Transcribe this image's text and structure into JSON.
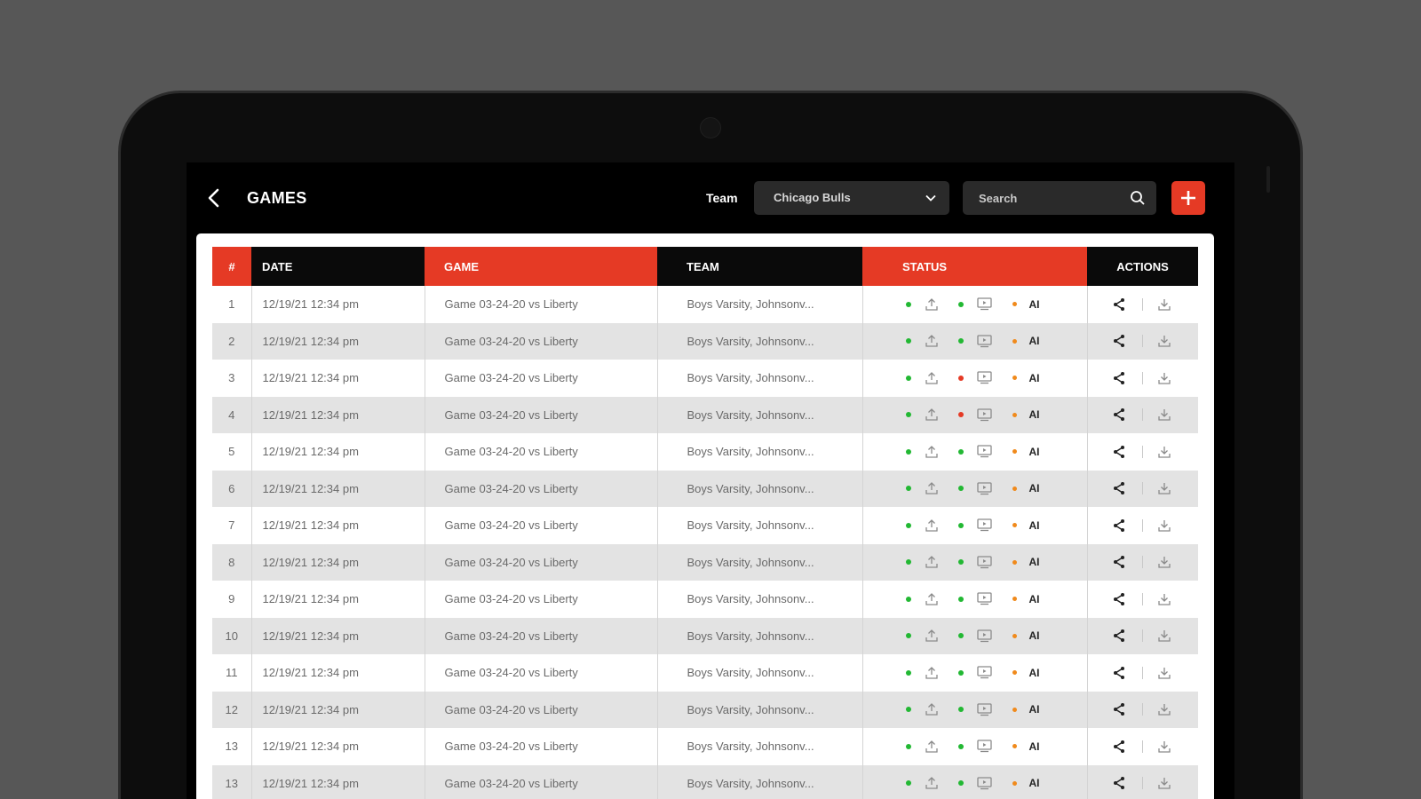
{
  "header": {
    "title": "GAMES",
    "team_label": "Team",
    "team_selected": "Chicago Bulls",
    "search_placeholder": "Search"
  },
  "colors": {
    "accent": "#e53a25",
    "status_green": "#22b833",
    "status_red": "#e53a25",
    "status_orange": "#f08a1c"
  },
  "icons": {
    "back": "chevron-left-icon",
    "dropdown": "chevron-down-icon",
    "search": "search-icon",
    "add": "plus-icon",
    "upload": "upload-icon",
    "video": "video-icon",
    "share": "share-icon",
    "download": "download-icon"
  },
  "table": {
    "columns": [
      "#",
      "DATE",
      "GAME",
      "TEAM",
      "STATUS",
      "ACTIONS"
    ],
    "status_ai_label": "AI",
    "rows": [
      {
        "num": "1",
        "date": "12/19/21  12:34 pm",
        "game": "Game 03-24-20 vs Liberty",
        "team": "Boys Varsity, Johnsonv...",
        "status2": "green"
      },
      {
        "num": "2",
        "date": "12/19/21  12:34 pm",
        "game": "Game 03-24-20 vs Liberty",
        "team": "Boys Varsity, Johnsonv...",
        "status2": "green"
      },
      {
        "num": "3",
        "date": "12/19/21  12:34 pm",
        "game": "Game 03-24-20 vs Liberty",
        "team": "Boys Varsity, Johnsonv...",
        "status2": "red"
      },
      {
        "num": "4",
        "date": "12/19/21  12:34 pm",
        "game": "Game 03-24-20 vs Liberty",
        "team": "Boys Varsity, Johnsonv...",
        "status2": "red"
      },
      {
        "num": "5",
        "date": "12/19/21  12:34 pm",
        "game": "Game 03-24-20 vs Liberty",
        "team": "Boys Varsity, Johnsonv...",
        "status2": "green"
      },
      {
        "num": "6",
        "date": "12/19/21  12:34 pm",
        "game": "Game 03-24-20 vs Liberty",
        "team": "Boys Varsity, Johnsonv...",
        "status2": "green"
      },
      {
        "num": "7",
        "date": "12/19/21  12:34 pm",
        "game": "Game 03-24-20 vs Liberty",
        "team": "Boys Varsity, Johnsonv...",
        "status2": "green"
      },
      {
        "num": "8",
        "date": "12/19/21  12:34 pm",
        "game": "Game 03-24-20 vs Liberty",
        "team": "Boys Varsity, Johnsonv...",
        "status2": "green"
      },
      {
        "num": "9",
        "date": "12/19/21  12:34 pm",
        "game": "Game 03-24-20 vs Liberty",
        "team": "Boys Varsity, Johnsonv...",
        "status2": "green"
      },
      {
        "num": "10",
        "date": "12/19/21  12:34 pm",
        "game": "Game 03-24-20 vs Liberty",
        "team": "Boys Varsity, Johnsonv...",
        "status2": "green"
      },
      {
        "num": "11",
        "date": "12/19/21  12:34 pm",
        "game": "Game 03-24-20 vs Liberty",
        "team": "Boys Varsity, Johnsonv...",
        "status2": "green"
      },
      {
        "num": "12",
        "date": "12/19/21  12:34 pm",
        "game": "Game 03-24-20 vs Liberty",
        "team": "Boys Varsity, Johnsonv...",
        "status2": "green"
      },
      {
        "num": "13",
        "date": "12/19/21  12:34 pm",
        "game": "Game 03-24-20 vs Liberty",
        "team": "Boys Varsity, Johnsonv...",
        "status2": "green"
      },
      {
        "num": "13",
        "date": "12/19/21  12:34 pm",
        "game": "Game 03-24-20 vs Liberty",
        "team": "Boys Varsity, Johnsonv...",
        "status2": "green"
      }
    ]
  }
}
